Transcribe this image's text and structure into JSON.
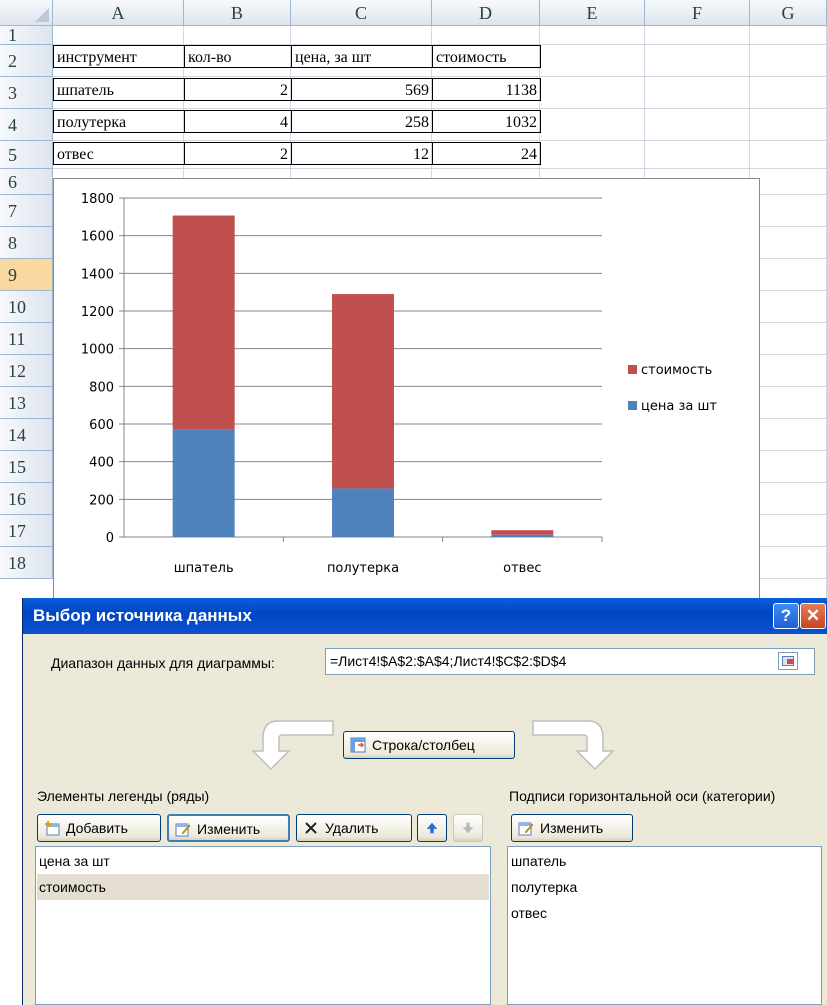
{
  "sheet": {
    "columns": [
      "A",
      "B",
      "C",
      "D",
      "E",
      "F",
      "G"
    ],
    "rows": [
      "1",
      "2",
      "3",
      "4",
      "5",
      "6",
      "7",
      "8",
      "9",
      "10",
      "11",
      "12",
      "13",
      "14",
      "15",
      "16",
      "17",
      "18"
    ],
    "selected_row": "9",
    "table": {
      "headers": [
        "инструмент",
        "кол-во",
        "цена, за шт",
        "стоимость"
      ],
      "rows": [
        [
          "шпатель",
          "2",
          "569",
          "1138"
        ],
        [
          "полутерка",
          "4",
          "258",
          "1032"
        ],
        [
          "отвес",
          "2",
          "12",
          "24"
        ]
      ]
    }
  },
  "chart_data": {
    "type": "bar",
    "stacked": true,
    "categories": [
      "шпатель",
      "полутерка",
      "отвес"
    ],
    "series": [
      {
        "name": "цена за шт",
        "values": [
          569,
          258,
          12
        ],
        "color": "#4f81bd"
      },
      {
        "name": "стоимость",
        "values": [
          1138,
          1032,
          24
        ],
        "color": "#c0504d"
      }
    ],
    "ylim": [
      0,
      1800
    ],
    "yticks": [
      "0",
      "200",
      "400",
      "600",
      "800",
      "1000",
      "1200",
      "1400",
      "1600",
      "1800"
    ],
    "grid": true,
    "legend_position": "right"
  },
  "dialog": {
    "title": "Выбор источника данных",
    "help_label": "?",
    "close_label": "✕",
    "range_label": "Диапазон данных для диаграммы:",
    "range_value": "=Лист4!$A$2:$A$4;Лист4!$C$2:$D$4",
    "switch_label": "Строка/столбец",
    "legend_header": "Элементы легенды (ряды)",
    "axis_header": "Подписи горизонтальной оси (категории)",
    "add_label": "Добавить",
    "edit_label": "Изменить",
    "delete_label": "Удалить",
    "axis_edit_label": "Изменить",
    "series_items": [
      "цена за шт",
      "стоимость"
    ],
    "category_items": [
      "шпатель",
      "полутерка",
      "отвес"
    ]
  }
}
